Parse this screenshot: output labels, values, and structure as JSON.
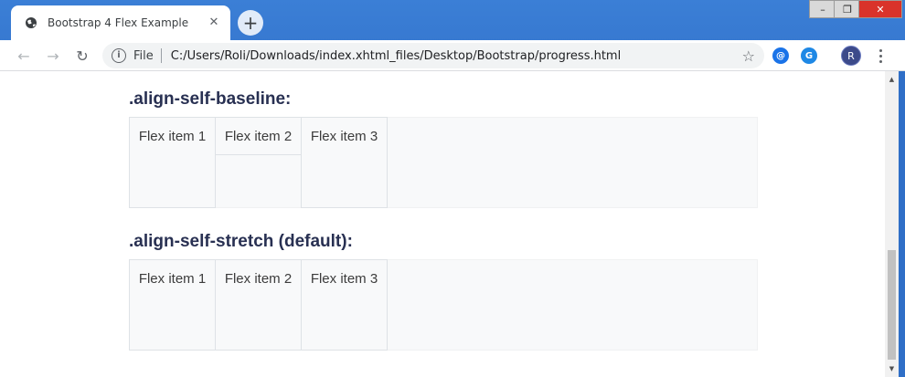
{
  "browser": {
    "tab": {
      "title": "Bootstrap 4 Flex Example",
      "close_glyph": "✕"
    },
    "new_tab_glyph": "+",
    "window_controls": {
      "minimize": "–",
      "maximize": "❐",
      "close": "✕"
    },
    "toolbar": {
      "back_glyph": "←",
      "forward_glyph": "→",
      "reload_glyph": "↻",
      "info_glyph": "i",
      "scheme_label": "File",
      "url": "C:/Users/Roli/Downloads/index.xhtml_files/Desktop/Bootstrap/progress.html",
      "star_glyph": "☆",
      "extension_1_glyph": "@",
      "extension_2_glyph": "G",
      "avatar_initial": "R"
    }
  },
  "page": {
    "sections": [
      {
        "heading": ".align-self-baseline:",
        "items": [
          "Flex item 1",
          "Flex item 2",
          "Flex item 3"
        ]
      },
      {
        "heading": ".align-self-stretch (default):",
        "items": [
          "Flex item 1",
          "Flex item 2",
          "Flex item 3"
        ]
      }
    ]
  },
  "scrollbar": {
    "up_glyph": "▲",
    "down_glyph": "▼"
  },
  "colors": {
    "heading": "#283052",
    "flex_bg": "#f8f9fa",
    "flex_border": "#dee2e6",
    "desktop_blue": "#2f6fc7"
  }
}
